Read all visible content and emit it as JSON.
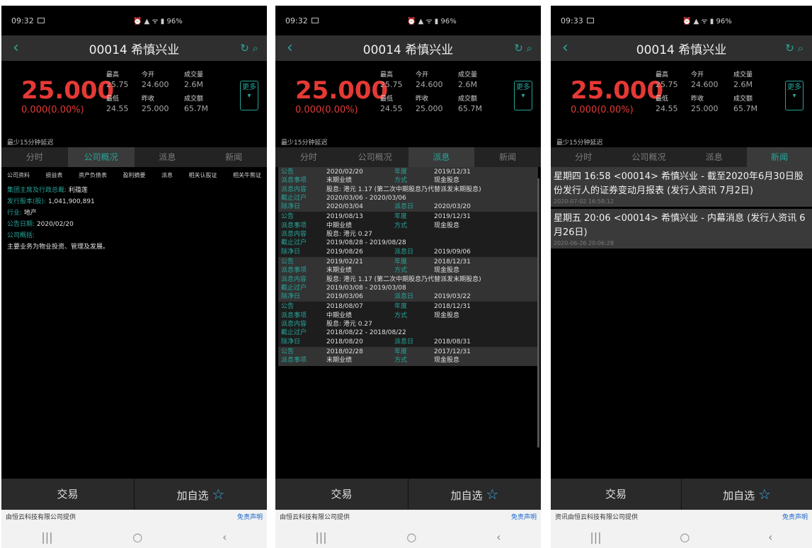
{
  "screens": [
    {
      "time": "09:32",
      "battery": "96%"
    },
    {
      "time": "09:32",
      "battery": "96%"
    },
    {
      "time": "09:33",
      "battery": "96%"
    }
  ],
  "header": {
    "title": "00014 希慎兴业"
  },
  "quote": {
    "price": "25.000",
    "change": "0.000(0.00%)",
    "high_label": "最高",
    "high": "25.75",
    "open_label": "今开",
    "open": "24.600",
    "volume_label": "成交量",
    "volume": "2.6M",
    "low_label": "最低",
    "low": "24.55",
    "prev_label": "昨收",
    "prev": "25.000",
    "turnover_label": "成交额",
    "turnover": "65.7M",
    "more": "更多",
    "delay": "最少15分钟延迟"
  },
  "tabs": [
    "分时",
    "公司概况",
    "派息",
    "新闻"
  ],
  "overview": {
    "subtabs": [
      "公司资料",
      "损益表",
      "资产负债表",
      "盈利摘要",
      "派息",
      "相关认股证",
      "相关牛熊证"
    ],
    "chairman_label": "集团主席及行政总裁:",
    "chairman": "利蕴莲",
    "shares_label": "发行股本(股):",
    "shares": "1,041,900,891",
    "industry_label": "行业:",
    "industry": "地产",
    "report_label": "公告日期:",
    "report_date": "2020/02/20",
    "summary_label": "公司概括:",
    "summary": "主要业务为物业投资、管理及发展。"
  },
  "dividend_labels": {
    "date": "公告",
    "year": "年度",
    "event": "派息事项",
    "method": "方式",
    "content": "派息内容",
    "book_close": "截止过户",
    "ex_date": "除净日",
    "pay_date": "派息日"
  },
  "dividends": [
    {
      "date": "2020/02/20",
      "year": "2019/12/31",
      "event": "末期业绩",
      "method": "现金股息",
      "content": "股息: 港元 1.17 (第二次中期股息乃代替派发末期股息)",
      "book_close": "2020/03/06 - 2020/03/06",
      "ex_date": "2020/03/04",
      "pay_date": "2020/03/20"
    },
    {
      "date": "2019/08/13",
      "year": "2019/12/31",
      "event": "中期业绩",
      "method": "现金股息",
      "content": "股息: 港元 0.27",
      "book_close": "2019/08/28 - 2019/08/28",
      "ex_date": "2019/08/26",
      "pay_date": "2019/09/06"
    },
    {
      "date": "2019/02/21",
      "year": "2018/12/31",
      "event": "末期业绩",
      "method": "现金股息",
      "content": "股息: 港元 1.17 (第二次中期股息乃代替派发末期股息)",
      "book_close": "2019/03/08 - 2019/03/08",
      "ex_date": "2019/03/06",
      "pay_date": "2019/03/22"
    },
    {
      "date": "2018/08/07",
      "year": "2018/12/31",
      "event": "中期业绩",
      "method": "现金股息",
      "content": "股息: 港元 0.27",
      "book_close": "2018/08/22 - 2018/08/22",
      "ex_date": "2018/08/20",
      "pay_date": "2018/08/31"
    },
    {
      "date": "2018/02/28",
      "year": "2017/12/31",
      "event": "末期业绩",
      "method": "现金股息",
      "content": "",
      "book_close": "",
      "ex_date": "",
      "pay_date": ""
    }
  ],
  "news": [
    {
      "headline": "星期四 16:58 <00014> 希慎兴业 - 截至2020年6月30日股份发行人的证券变动月报表 (发行人资讯 7月2日)",
      "time": "2020-07-02 16:58:12"
    },
    {
      "headline": "星期五 20:06 <00014> 希慎兴业 - 内幕消息 (发行人资讯 6月26日)",
      "time": "2020-06-26 20:06:28"
    }
  ],
  "bottom": {
    "trade": "交易",
    "watch": "加自选"
  },
  "footer": {
    "left1": "由恒云科技有限公司提供",
    "left3": "资讯由恒云科技有限公司提供",
    "disclaimer": "免责声明"
  }
}
